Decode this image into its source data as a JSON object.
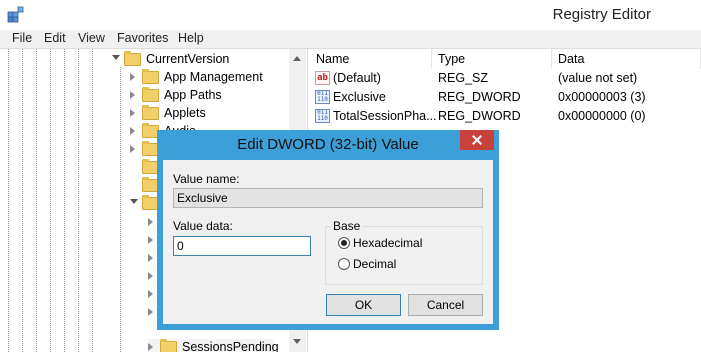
{
  "window": {
    "title": "Registry Editor"
  },
  "menu": [
    "File",
    "Edit",
    "View",
    "Favorites",
    "Help"
  ],
  "tree": {
    "items": [
      {
        "label": "CurrentVersion",
        "expanded": true
      },
      {
        "label": "App Management",
        "expanded": false
      },
      {
        "label": "App Paths",
        "expanded": false
      },
      {
        "label": "Applets",
        "expanded": false
      },
      {
        "label": "Audio",
        "expanded": false
      },
      {
        "label": "SessionsPending",
        "expanded": false
      }
    ]
  },
  "list": {
    "columns": [
      "Name",
      "Type",
      "Data"
    ],
    "rows": [
      {
        "name": "(Default)",
        "type": "REG_SZ",
        "data": "(value not set)",
        "icon": "string-value-icon"
      },
      {
        "name": "Exclusive",
        "type": "REG_DWORD",
        "data": "0x00000003 (3)",
        "icon": "dword-value-icon"
      },
      {
        "name": "TotalSessionPha...",
        "type": "REG_DWORD",
        "data": "0x00000000 (0)",
        "icon": "dword-value-icon"
      }
    ]
  },
  "dialog": {
    "title": "Edit DWORD (32-bit) Value",
    "value_name_label": "Value name:",
    "value_name": "Exclusive",
    "value_data_label": "Value data:",
    "value_data": "0",
    "base_label": "Base",
    "hex_label": "Hexadecimal",
    "dec_label": "Decimal",
    "selected_base": "Hexadecimal",
    "ok_label": "OK",
    "cancel_label": "Cancel"
  },
  "colors": {
    "dialog_frame": "#3c9fd8",
    "close_button": "#c8413a",
    "folder": "#f2cf68"
  }
}
